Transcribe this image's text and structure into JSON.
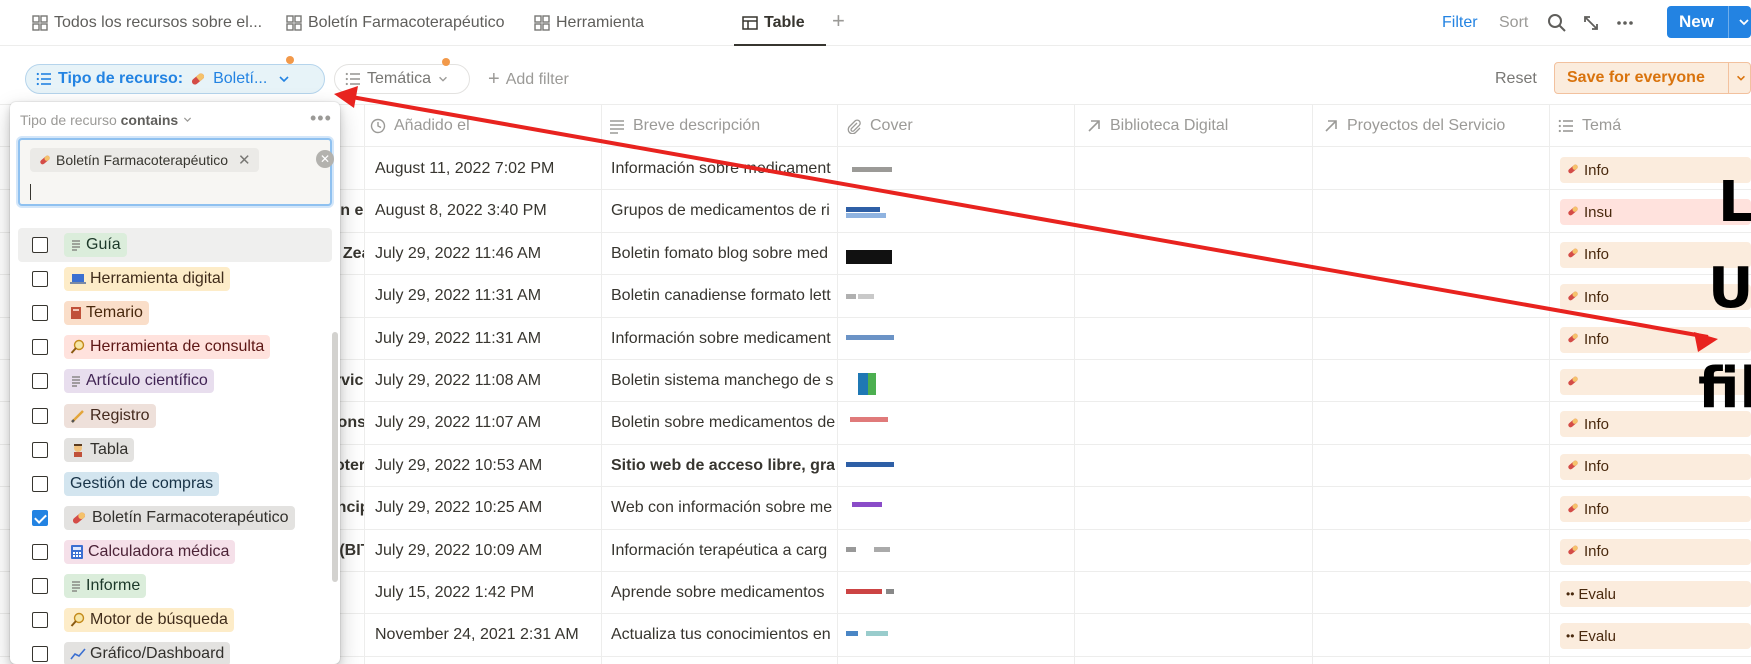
{
  "tabs": [
    {
      "label": "Todos los recursos sobre el...",
      "icon": "gallery-icon",
      "active": false
    },
    {
      "label": "Boletín Farmacoterapéutico",
      "icon": "gallery-icon",
      "active": false
    },
    {
      "label": "Herramienta",
      "icon": "gallery-icon",
      "active": false
    },
    {
      "label": "Table",
      "icon": "table-icon",
      "active": true
    }
  ],
  "toolbar": {
    "filter_label": "Filter",
    "sort_label": "Sort",
    "new_label": "New"
  },
  "filters": {
    "active_prefix": "Tipo de recurso:",
    "active_value": "Boletí...",
    "tematica_label": "Temática",
    "add_filter_label": "Add filter",
    "reset_label": "Reset",
    "save_label": "Save for everyone"
  },
  "columns": [
    {
      "label": "Añadido el",
      "icon": "clock-icon"
    },
    {
      "label": "Breve descripción",
      "icon": "text-icon"
    },
    {
      "label": "Cover",
      "icon": "paperclip-icon"
    },
    {
      "label": "Biblioteca Digital",
      "icon": "relation-arrow-icon"
    },
    {
      "label": "Proyectos del Servicio",
      "icon": "relation-arrow-icon"
    },
    {
      "label": "Temá",
      "icon": "list-icon"
    }
  ],
  "rows": [
    {
      "name_tail": "",
      "date": "August 11, 2022 7:02 PM",
      "desc": "Información sobre medicament",
      "desc_bold": false,
      "tematica": "Info",
      "tematica_color": "#fbecdd"
    },
    {
      "name_tail": "ión e",
      "date": "August 8, 2022 3:40 PM",
      "desc": "Grupos de medicamentos de ri",
      "desc_bold": false,
      "tematica": "Insu",
      "tematica_color": "#ffe2dd"
    },
    {
      "name_tail": "w Zea",
      "date": "July 29, 2022 11:46 AM",
      "desc": "Boletin fomato blog sobre med",
      "desc_bold": false,
      "tematica": "Info",
      "tematica_color": "#fbecdd"
    },
    {
      "name_tail": "",
      "date": "July 29, 2022 11:31 AM",
      "desc": "Boletin canadiense formato lett",
      "desc_bold": false,
      "tematica": "Info",
      "tematica_color": "#fbecdd"
    },
    {
      "name_tail": "",
      "date": "July 29, 2022 11:31 AM",
      "desc": "Información sobre medicament",
      "desc_bold": false,
      "tematica": "Info",
      "tematica_color": "#fbecdd"
    },
    {
      "name_tail": "ervici",
      "date": "July 29, 2022 11:08 AM",
      "desc": "Boletin sistema manchego de s",
      "desc_bold": false,
      "tematica": "",
      "tematica_color": "#fbecdd"
    },
    {
      "name_tail": "Conse",
      "date": "July 29, 2022 11:07 AM",
      "desc": "Boletin sobre medicamentos de",
      "desc_bold": false,
      "tematica": "Info",
      "tematica_color": "#fbecdd"
    },
    {
      "name_tail": "coter",
      "date": "July 29, 2022 10:53 AM",
      "desc": "Sitio web de acceso libre, grat",
      "desc_bold": true,
      "tematica": "Info",
      "tematica_color": "#fbecdd"
    },
    {
      "name_tail": "rincip",
      "date": "July 29, 2022 10:25 AM",
      "desc": "Web con información sobre me",
      "desc_bold": false,
      "tematica": "Info",
      "tematica_color": "#fbecdd"
    },
    {
      "name_tail": "a (BIT",
      "date": "July 29, 2022 10:09 AM",
      "desc": "Información terapéutica a carg",
      "desc_bold": false,
      "tematica": "Info",
      "tematica_color": "#fbecdd"
    },
    {
      "name_tail": "",
      "date": "July 15, 2022 1:42 PM",
      "desc": "Aprende sobre medicamentos",
      "desc_bold": false,
      "tematica": "Evalu",
      "tematica_color": "#fbecdd"
    },
    {
      "name_tail": "",
      "date": "November 24, 2021 2:31 AM",
      "desc": "Actualiza tus conocimientos en",
      "desc_bold": false,
      "tematica": "Evalu",
      "tematica_color": "#fbecdd"
    }
  ],
  "dropdown": {
    "header_prefix": "Tipo de recurso",
    "header_op": "contains",
    "selected_chip": "Boletín Farmacoterapéutico",
    "options": [
      {
        "label": "Guía",
        "bg": "#dbeddb",
        "fg": "#1c3829",
        "checked": false,
        "icon": "doc-icon"
      },
      {
        "label": "Herramienta digital",
        "bg": "#fdecc8",
        "fg": "#402c1b",
        "checked": false,
        "icon": "laptop-icon"
      },
      {
        "label": "Temario",
        "bg": "#fadec9",
        "fg": "#49290e",
        "checked": false,
        "icon": "book-icon"
      },
      {
        "label": "Herramienta de consulta",
        "bg": "#ffe2dd",
        "fg": "#5d1715",
        "checked": false,
        "icon": "magnifier-icon"
      },
      {
        "label": "Artículo científico",
        "bg": "#e8deee",
        "fg": "#412454",
        "checked": false,
        "icon": "doc-icon"
      },
      {
        "label": "Registro",
        "bg": "#eee0da",
        "fg": "#442a1e",
        "checked": false,
        "icon": "pencil-icon"
      },
      {
        "label": "Tabla",
        "bg": "#e3e2e0",
        "fg": "#32302c",
        "checked": false,
        "icon": "person-icon"
      },
      {
        "label": "Gestión de compras",
        "bg": "#d3e5ef",
        "fg": "#183347",
        "checked": false,
        "icon": ""
      },
      {
        "label": "Boletín Farmacoterapéutico",
        "bg": "#e3e2e0",
        "fg": "#32302c",
        "checked": true,
        "icon": "pill-icon"
      },
      {
        "label": "Calculadora médica",
        "bg": "#f5e0e9",
        "fg": "#4c2337",
        "checked": false,
        "icon": "calculator-icon"
      },
      {
        "label": "Informe",
        "bg": "#dbeddb",
        "fg": "#1c3829",
        "checked": false,
        "icon": "doc-icon"
      },
      {
        "label": "Motor de búsqueda",
        "bg": "#fdecc8",
        "fg": "#402c1b",
        "checked": false,
        "icon": "magnifier-icon"
      },
      {
        "label": "Gráfico/Dashboard",
        "bg": "#e3e2e0",
        "fg": "#32302c",
        "checked": false,
        "icon": "chart-icon"
      }
    ]
  },
  "overlay_text": [
    "L",
    "U",
    "fil"
  ],
  "colors": {
    "accent": "#2383e2",
    "annotation_red": "#e8231f",
    "save_orange": "#d9730d"
  }
}
